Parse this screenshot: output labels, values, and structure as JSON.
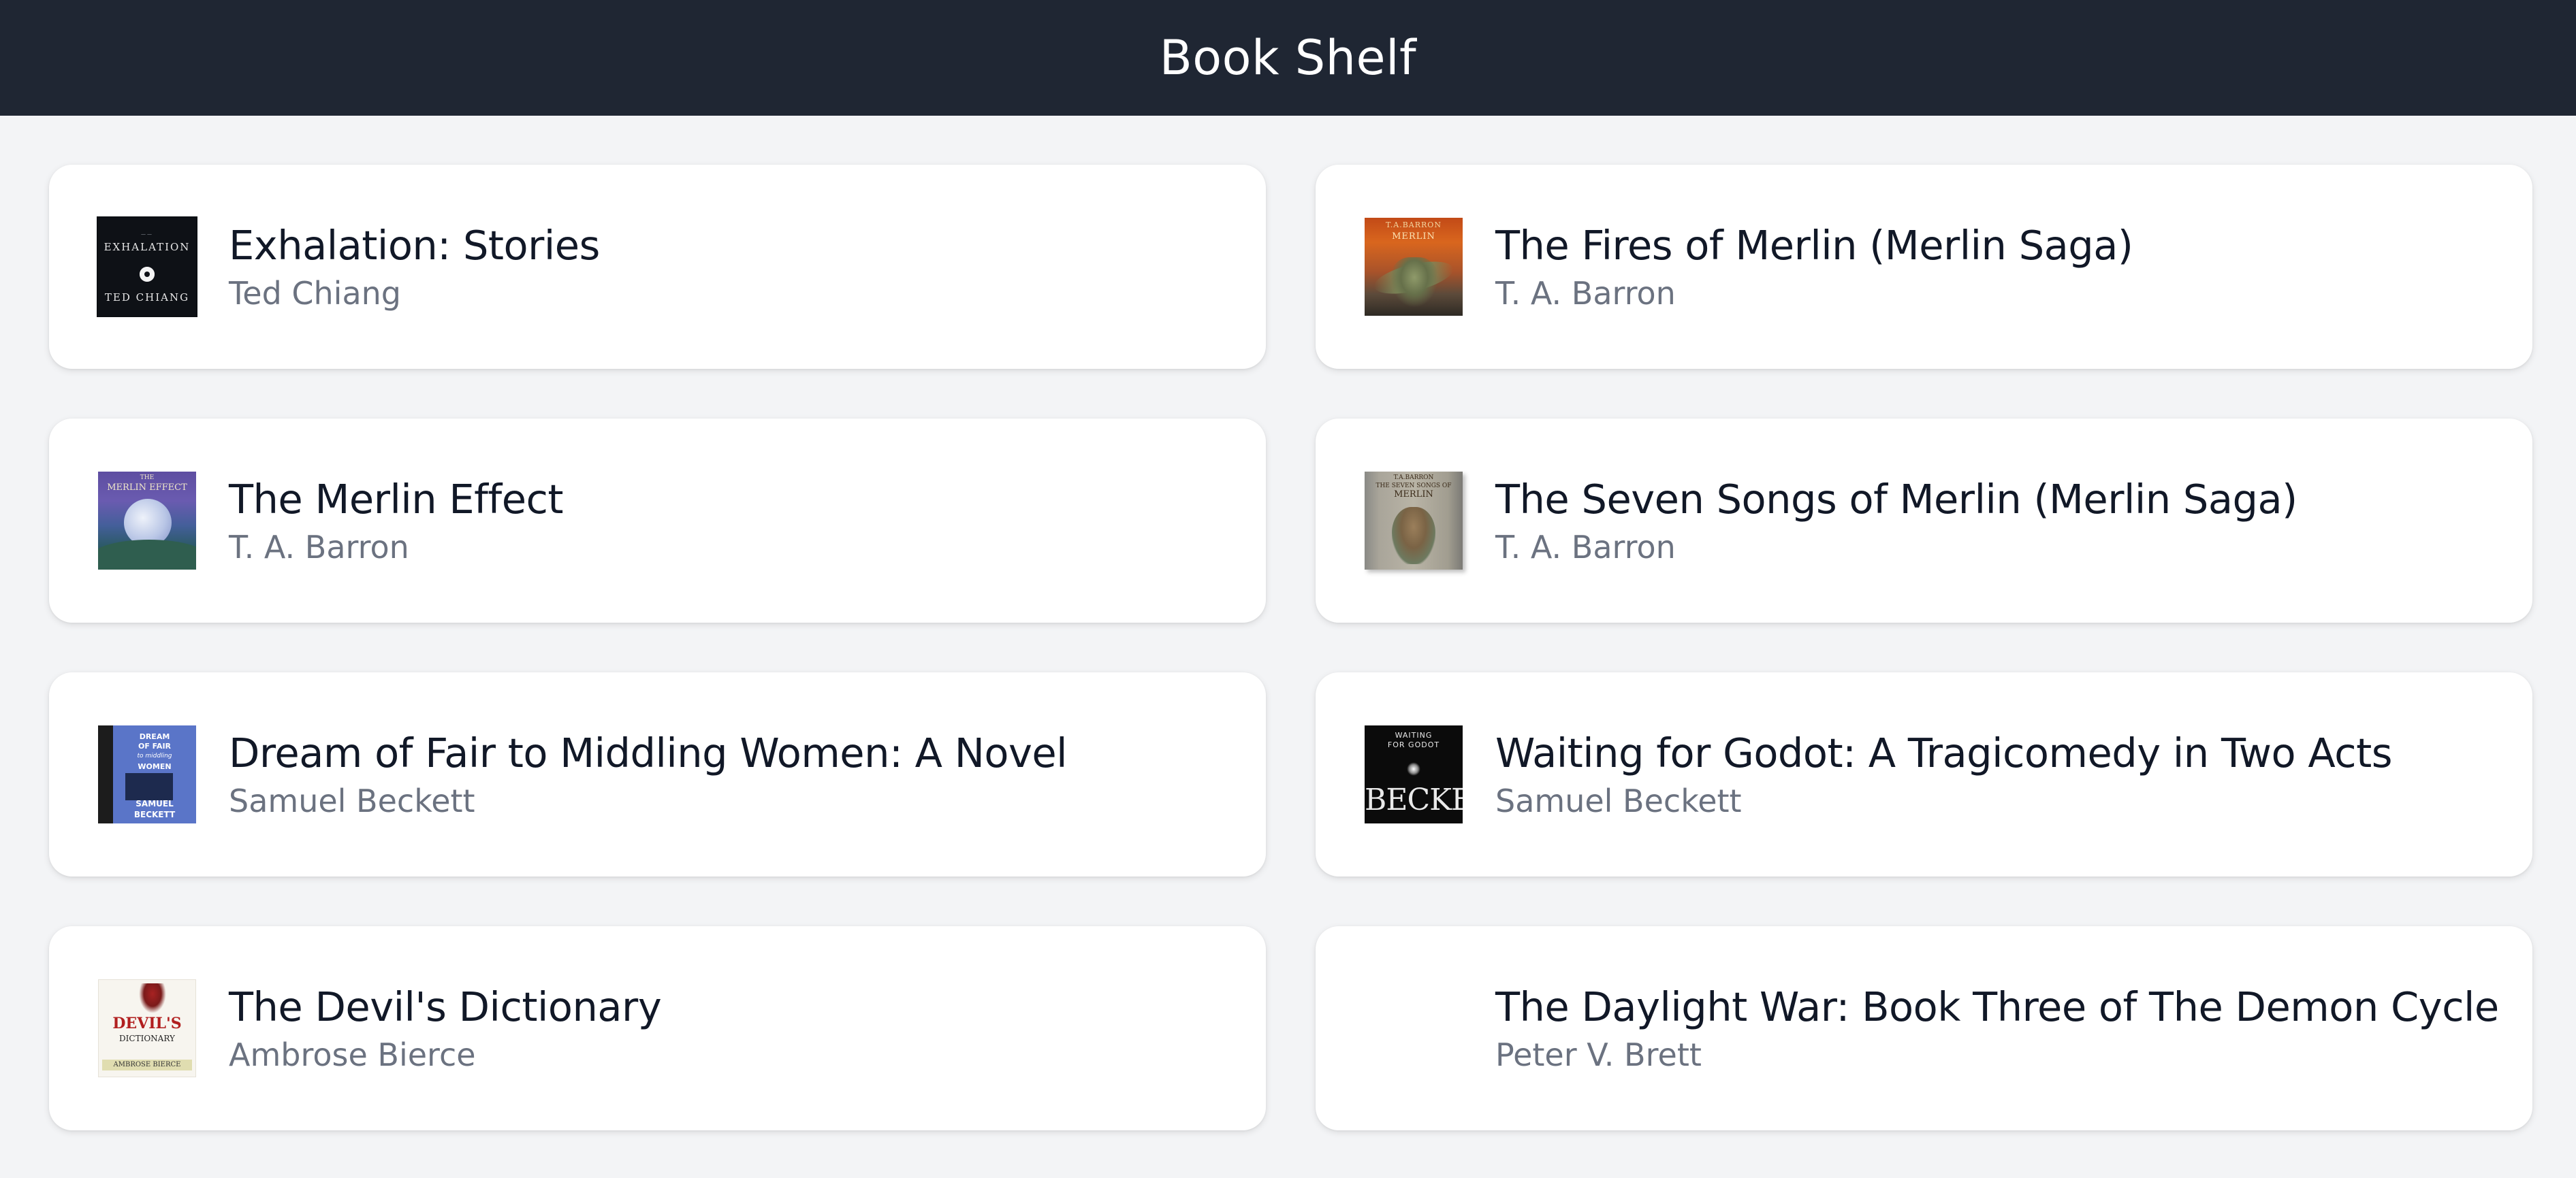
{
  "header": {
    "title": "Book Shelf"
  },
  "books": [
    {
      "title": "Exhalation: Stories",
      "author": "Ted Chiang",
      "cover": {
        "icon": "book-cover-image",
        "line1": "EXHALATION",
        "line2": "TED CHIANG",
        "tagline": "——"
      }
    },
    {
      "title": "The Fires of Merlin (Merlin Saga)",
      "author": "T. A. Barron",
      "cover": {
        "icon": "book-cover-image",
        "line1": "T.A.BARRON",
        "line2": "MERLIN"
      }
    },
    {
      "title": "The Merlin Effect",
      "author": "T. A. Barron",
      "cover": {
        "icon": "book-cover-image",
        "line1": "THE",
        "line2": "MERLIN EFFECT"
      }
    },
    {
      "title": "The Seven Songs of Merlin (Merlin Saga)",
      "author": "T. A. Barron",
      "cover": {
        "icon": "book-cover-image",
        "line1": "T.A.BARRON",
        "line2": "THE SEVEN SONGS OF",
        "line3": "MERLIN"
      }
    },
    {
      "title": "Dream of Fair to Middling Women: A Novel",
      "author": "Samuel Beckett",
      "cover": {
        "icon": "book-cover-image",
        "line1": "DREAM",
        "line2": "OF FAIR",
        "line3": "to middling",
        "line4": "WOMEN",
        "line5": "SAMUEL",
        "line6": "BECKETT"
      }
    },
    {
      "title": "Waiting for Godot: A Tragicomedy in Two Acts",
      "author": "Samuel Beckett",
      "cover": {
        "icon": "book-cover-image",
        "line1": "WAITING",
        "line2": "FOR GODOT",
        "line3": "BECKETT"
      }
    },
    {
      "title": "The Devil's Dictionary",
      "author": "Ambrose Bierce",
      "cover": {
        "icon": "book-cover-image",
        "line1": "DEVIL'S",
        "line2": "DICTIONARY",
        "line3": "AMBROSE BIERCE"
      }
    },
    {
      "title": "The Daylight War: Book Three of The Demon Cycle",
      "author": "Peter V. Brett",
      "cover": {
        "icon": "book-cover-placeholder"
      }
    }
  ]
}
